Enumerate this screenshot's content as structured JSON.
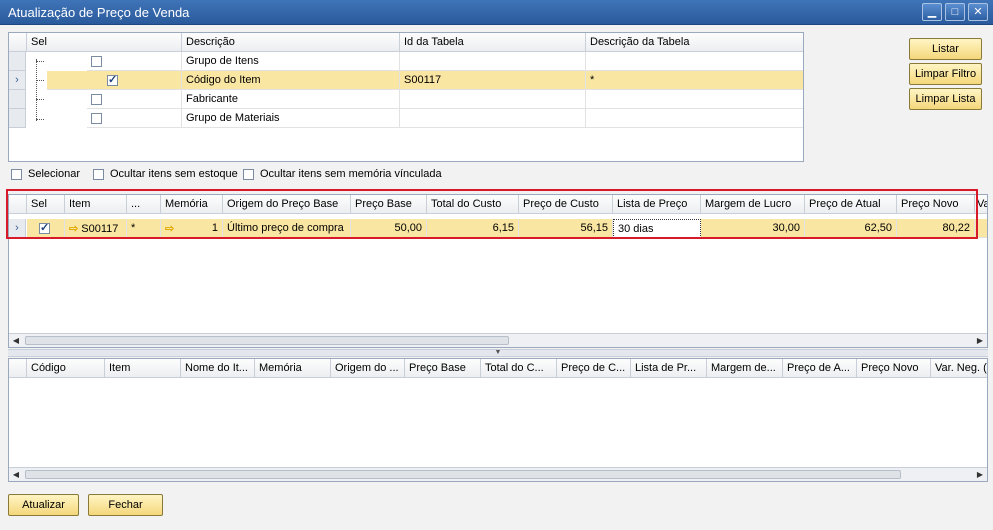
{
  "window": {
    "title": "Atualização de Preço de Venda",
    "min": "▁",
    "max": "□",
    "close": "✕"
  },
  "filter_grid": {
    "headers": [
      "Sel",
      "Descrição",
      "Id da Tabela",
      "Descrição da Tabela"
    ],
    "rows": [
      {
        "sel": false,
        "descricao": "Grupo de Itens",
        "id": "",
        "desc_tabela": ""
      },
      {
        "sel": true,
        "descricao": "Código do Item",
        "id": "S00117",
        "desc_tabela": "*"
      },
      {
        "sel": false,
        "descricao": "Fabricante",
        "id": "",
        "desc_tabela": ""
      },
      {
        "sel": false,
        "descricao": "Grupo de Materiais",
        "id": "",
        "desc_tabela": ""
      }
    ]
  },
  "side_buttons": {
    "listar": "Listar",
    "limpar_filtro": "Limpar Filtro",
    "limpar_lista": "Limpar Lista"
  },
  "options": {
    "selecionar": "Selecionar",
    "ocultar_estoque": "Ocultar itens sem estoque",
    "ocultar_memoria": "Ocultar itens sem memória vínculada"
  },
  "items_grid": {
    "headers": [
      "Sel",
      "Item",
      "...",
      "Memória",
      "Origem do Preço Base",
      "Preço Base",
      "Total do Custo",
      "Preço de Custo",
      "Lista de Preço",
      "Margem de Lucro",
      "Preço de Atual",
      "Preço Novo",
      "Va"
    ],
    "row": {
      "sel": true,
      "item": "S00117",
      "dots": "*",
      "memoria": "1",
      "origem": "Último preço de compra",
      "preco_base": "50,00",
      "total_custo": "6,15",
      "preco_custo": "56,15",
      "lista": "30 dias",
      "margem": "30,00",
      "preco_atual": "62,50",
      "preco_novo": "80,22"
    }
  },
  "result_grid": {
    "headers": [
      "Código",
      "Item",
      "Nome do It...",
      "Memória",
      "Origem do ...",
      "Preço Base",
      "Total do C...",
      "Preço de C...",
      "Lista de Pr...",
      "Margem de...",
      "Preço de A...",
      "Preço Novo",
      "Var. Neg. (..."
    ]
  },
  "footer": {
    "atualizar": "Atualizar",
    "fechar": "Fechar"
  },
  "colors": {
    "title_bar": "#2a5a9c",
    "selected_row": "#fae6a3",
    "button": "#f4d77b",
    "highlight_border": "#d8192a"
  }
}
